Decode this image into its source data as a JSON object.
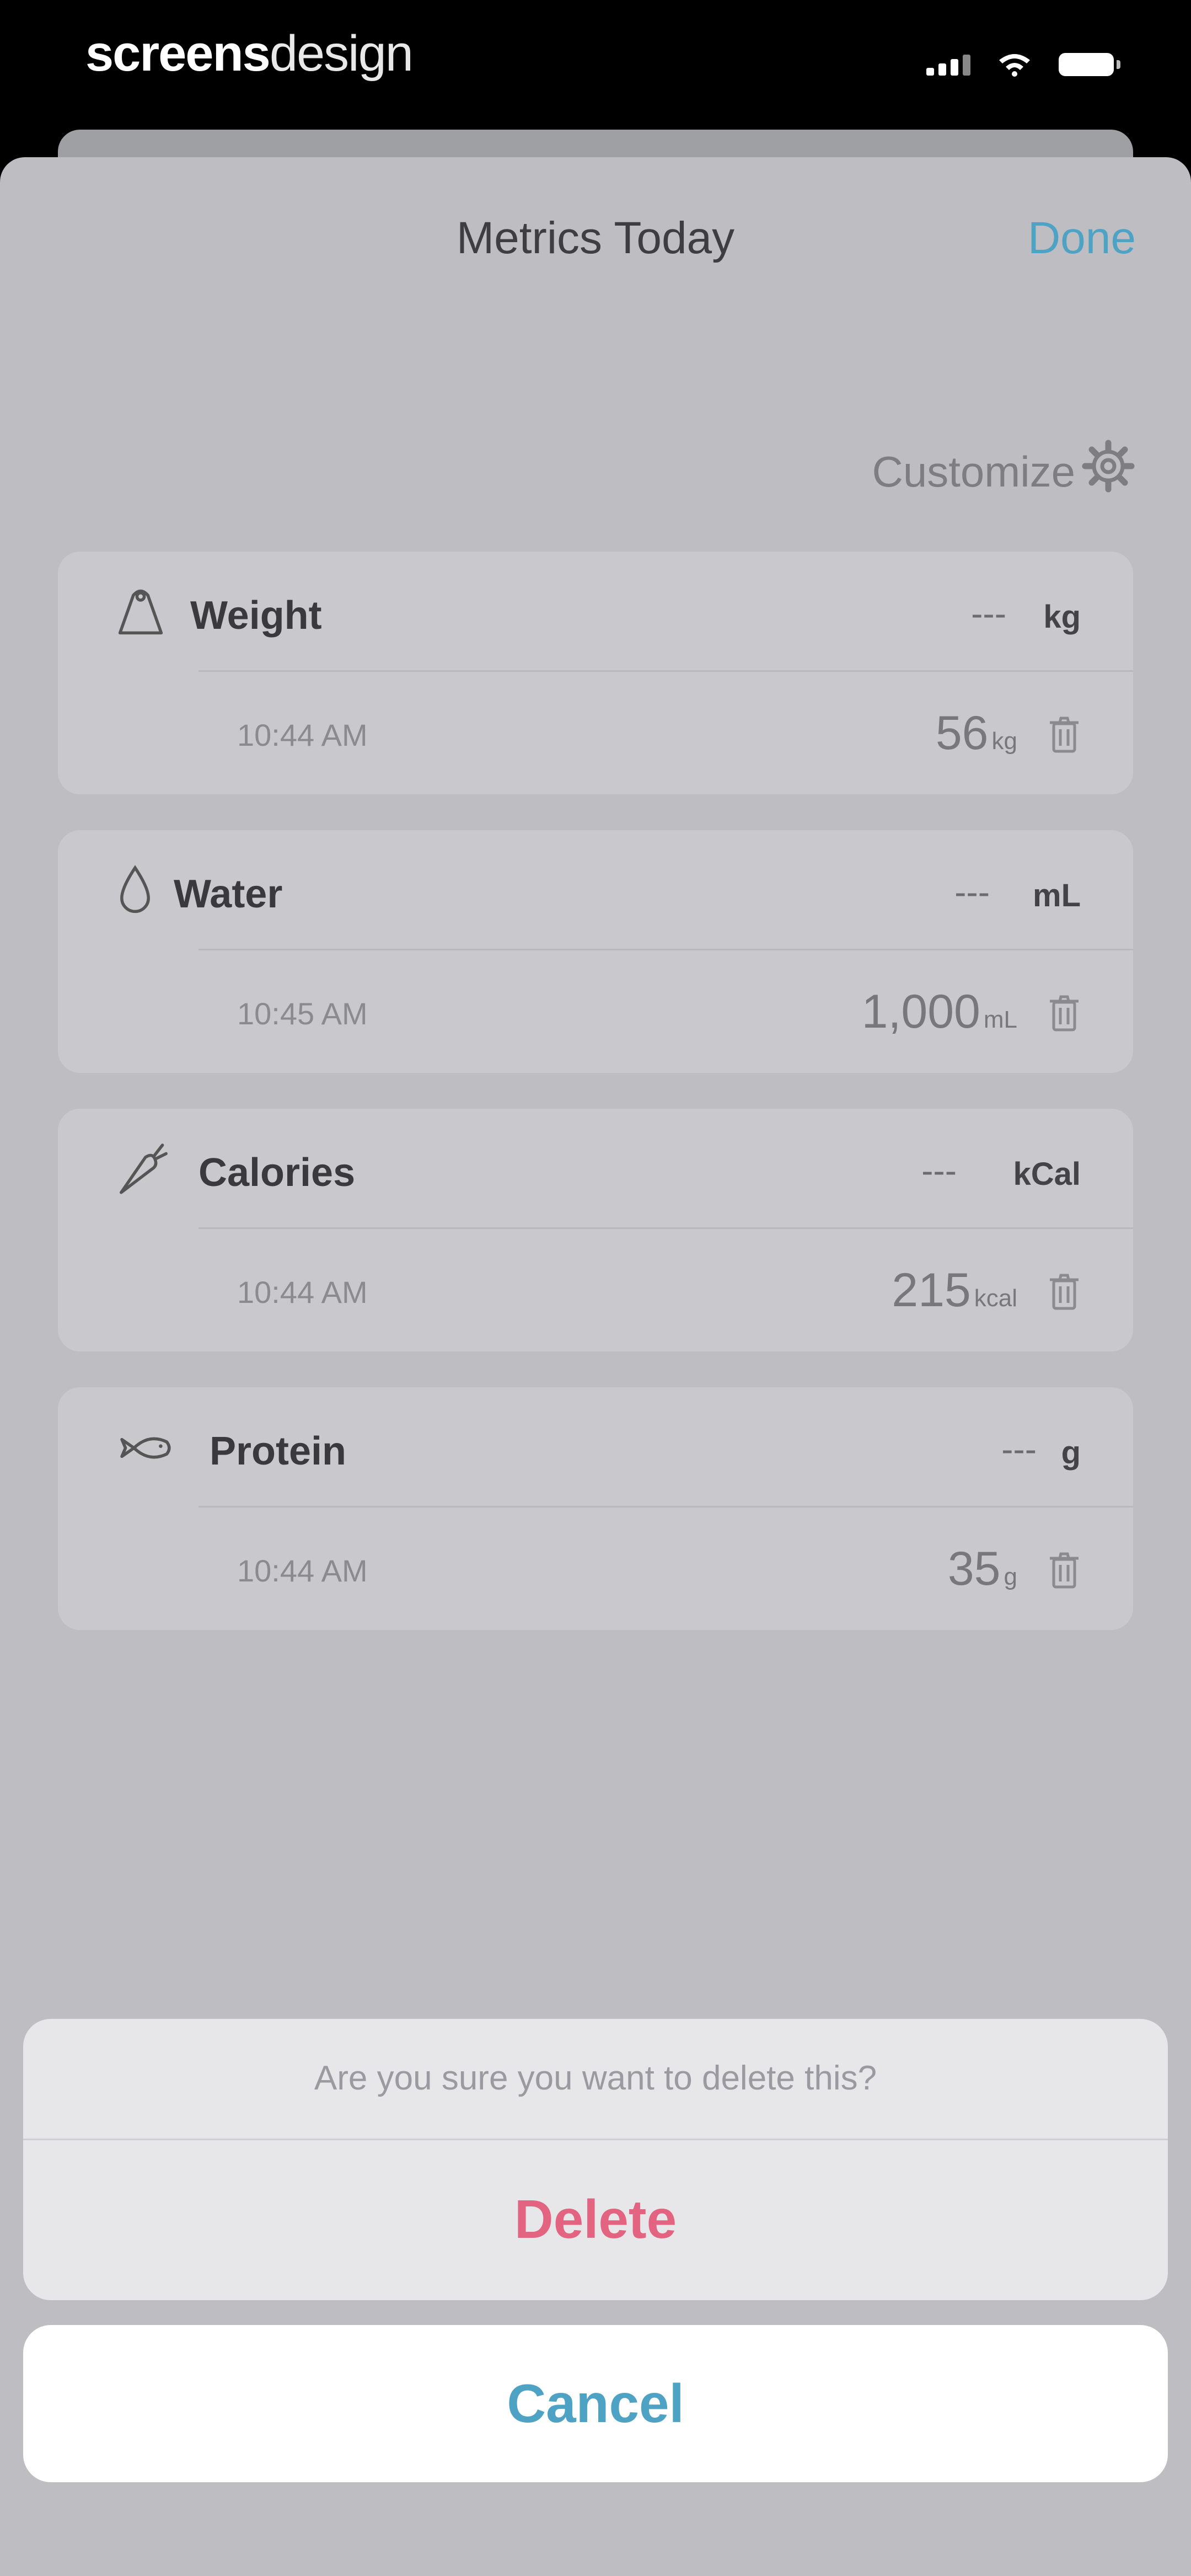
{
  "status_bar": {
    "brand_bold": "screens",
    "brand_light": "design"
  },
  "nav": {
    "title": "Metrics Today",
    "done_label": "Done"
  },
  "customize": {
    "label": "Customize",
    "icon": "gear-icon"
  },
  "metrics": [
    {
      "name": "Weight",
      "icon": "weight-icon",
      "placeholder": "---",
      "unit": "kg",
      "time": "10:44 AM",
      "value": "56",
      "value_unit": "kg"
    },
    {
      "name": "Water",
      "icon": "water-drop-icon",
      "placeholder": "---",
      "unit": "mL",
      "time": "10:45 AM",
      "value": "1,000",
      "value_unit": "mL"
    },
    {
      "name": "Calories",
      "icon": "carrot-icon",
      "placeholder": "---",
      "unit": "kCal",
      "time": "10:44 AM",
      "value": "215",
      "value_unit": "kcal"
    },
    {
      "name": "Protein",
      "icon": "fish-icon",
      "placeholder": "---",
      "unit": "g",
      "time": "10:44 AM",
      "value": "35",
      "value_unit": "g"
    }
  ],
  "action_sheet": {
    "message": "Are you sure you want to delete this?",
    "delete_label": "Delete",
    "cancel_label": "Cancel"
  },
  "colors": {
    "accent": "#4ea2c4",
    "destructive": "#e26480"
  }
}
